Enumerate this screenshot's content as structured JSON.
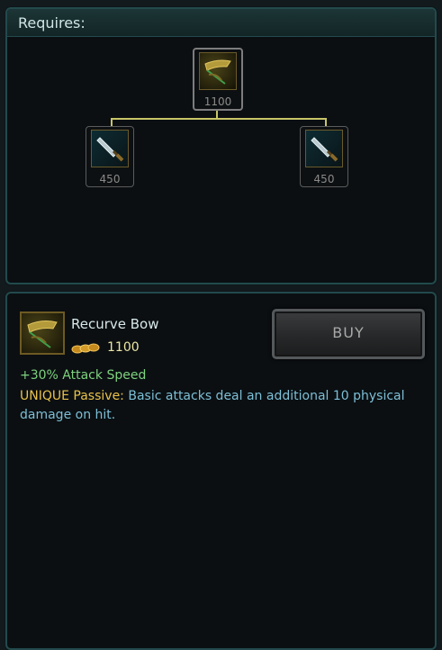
{
  "requires": {
    "title": "Requires:",
    "root": {
      "name": "Recurve Bow",
      "icon": "bow-icon",
      "price": "1100"
    },
    "components": [
      {
        "name": "Dagger",
        "icon": "dagger-icon",
        "price": "450"
      },
      {
        "name": "Dagger",
        "icon": "dagger-icon",
        "price": "450"
      }
    ]
  },
  "item": {
    "name": "Recurve Bow",
    "icon": "bow-icon",
    "gold_icon": "gold-coins-icon",
    "cost": "1100",
    "buy_label": "BUY",
    "stat": "+30% Attack Speed",
    "passive_label": "UNIQUE Passive:",
    "passive_text": "Basic attacks deal an additional 10 physical damage on hit."
  },
  "colors": {
    "border": "#234a4d",
    "stat_green": "#7ed27e",
    "unique_gold": "#e8c24a",
    "description_blue": "#7dbfd6",
    "tree_line": "#c9c566"
  }
}
